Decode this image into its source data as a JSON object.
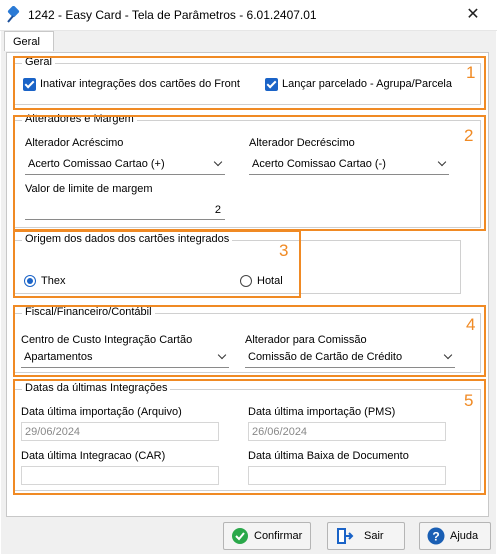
{
  "window": {
    "title": "1242 - Easy Card - Tela de Parâmetros - 6.01.2407.01",
    "close_glyph": "✕"
  },
  "tabs": [
    {
      "label": "Geral"
    }
  ],
  "geral": {
    "legend": "Geral",
    "number": "1",
    "inativar_label": "Inativar integrações dos cartões do Front",
    "inativar_checked": true,
    "lancar_label": "Lançar parcelado - Agrupa/Parcela",
    "lancar_checked": true
  },
  "alteradores": {
    "legend": "Alteradores e Margem",
    "number": "2",
    "acrescimo_label": "Alterador Acréscimo",
    "acrescimo_value": "Acerto Comissao Cartao (+)",
    "decrescimo_label": "Alterador Decréscimo",
    "decrescimo_value": "Acerto Comissao Cartao (-)",
    "limite_label": "Valor de limite de margem",
    "limite_value": "2"
  },
  "origem": {
    "legend": "Origem dos dados dos cartões integrados",
    "number": "3",
    "thex_label": "Thex",
    "hotal_label": "Hotal",
    "selected": "Thex"
  },
  "fiscal": {
    "legend": "Fiscal/Financeiro/Contábil",
    "number": "4",
    "centro_label": "Centro de Custo Integração Cartão",
    "centro_value": "Apartamentos",
    "comissao_label": "Alterador para Comissão",
    "comissao_value": "Comissão de Cartão de Crédito"
  },
  "datas": {
    "legend": "Datas da últimas Integrações",
    "number": "5",
    "arquivo_label": "Data última importação (Arquivo)",
    "arquivo_value": "29/06/2024",
    "pms_label": "Data última importação (PMS)",
    "pms_value": "26/06/2024",
    "car_label": "Data última Integracao (CAR)",
    "car_value": "",
    "baixa_label": "Data última Baixa de Documento",
    "baixa_value": ""
  },
  "buttons": {
    "confirmar": "Confirmar",
    "sair": "Sair",
    "ajuda": "Ajuda"
  },
  "colors": {
    "accent": "#1a63c7",
    "highlight": "#f08a24",
    "confirm": "#2aa84a"
  },
  "icons": [
    "pin-app-icon",
    "close-icon",
    "check-circle-icon",
    "exit-door-icon",
    "help-icon",
    "chevron-down-icon"
  ]
}
